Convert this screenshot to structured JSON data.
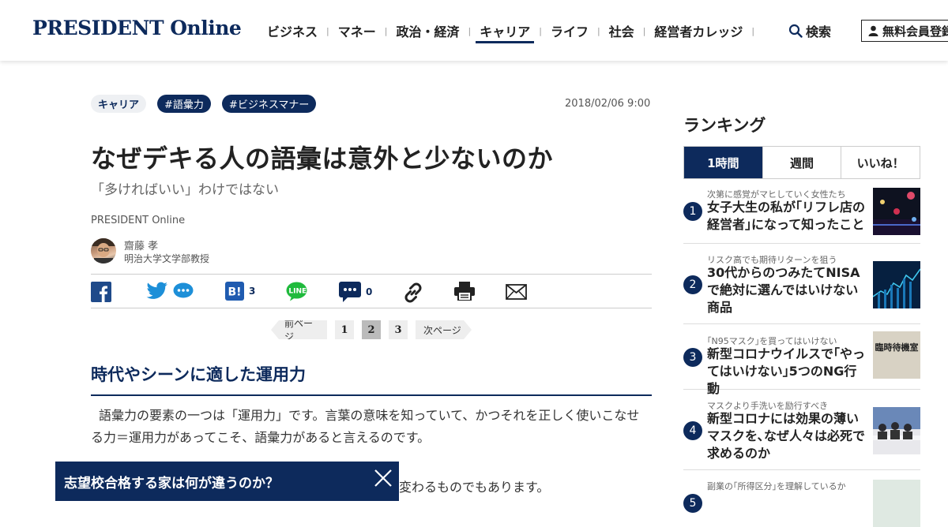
{
  "header": {
    "logo": "PRESIDENT Online",
    "nav": [
      {
        "label": "ビジネス",
        "active": false
      },
      {
        "label": "マネー",
        "active": false
      },
      {
        "label": "政治・経済",
        "active": false
      },
      {
        "label": "キャリア",
        "active": true
      },
      {
        "label": "ライフ",
        "active": false
      },
      {
        "label": "社会",
        "active": false
      },
      {
        "label": "経営者カレッジ",
        "active": false
      }
    ],
    "nav_separator": "|",
    "search_label": "検索",
    "member_label": "無料会員登録"
  },
  "article": {
    "category": "キャリア",
    "hashtags": [
      "#語彙力",
      "#ビジネスマナー"
    ],
    "date": "2018/02/06 9:00",
    "title": "なぜデキる人の語彙は意外と少ないのか",
    "subtitle": "「多ければいい」わけではない",
    "source": "PRESIDENT Online",
    "author_name": "齋藤 孝",
    "author_title": "明治大学文学部教授",
    "share": {
      "hatena_count": "3",
      "comment_count": "0"
    },
    "pager": {
      "prev": "前ページ",
      "pages": [
        "1",
        "2",
        "3"
      ],
      "current": "2",
      "next": "次ページ"
    },
    "section_heading": "時代やシーンに適した運用力",
    "paragraph1": "語彙力の要素の一つは「運用力」です。言葉の意味を知っていて、かつそれを正しく使いこなせる力＝運用力があってこそ、語彙力があると言えるのです。",
    "paragraph2_visible": "変わるものでもあります。"
  },
  "banner": {
    "text": "志望校合格する家は何が違うのか？"
  },
  "ranking": {
    "title": "ランキング",
    "tabs": [
      {
        "label": "1時間",
        "active": true
      },
      {
        "label": "週間",
        "active": false
      },
      {
        "label": "いいね！",
        "active": false
      }
    ],
    "items": [
      {
        "num": "1",
        "kicker": "次第に感覚がマヒしていく女性たち",
        "headline": "女子大生の私が｢リフレ店の経営者｣になって知ったこと"
      },
      {
        "num": "2",
        "kicker": "リスク高でも期待リターンを狙う",
        "headline": "30代からのつみたてNISAで絶対に選んではいけない商品"
      },
      {
        "num": "3",
        "kicker": "｢N95マスク｣を買ってはいけない",
        "headline": "新型コロナウイルスで｢やってはいけない｣5つのNG行動"
      },
      {
        "num": "4",
        "kicker": "マスクより手洗いを励行すべき",
        "headline": "新型コロナには効果の薄いマスクを､なぜ人々は必死で求めるのか"
      },
      {
        "num": "5",
        "kicker": "副業の｢所得区分｣を理解しているか",
        "headline": ""
      }
    ],
    "thumb3_text": "臨時待機室"
  }
}
